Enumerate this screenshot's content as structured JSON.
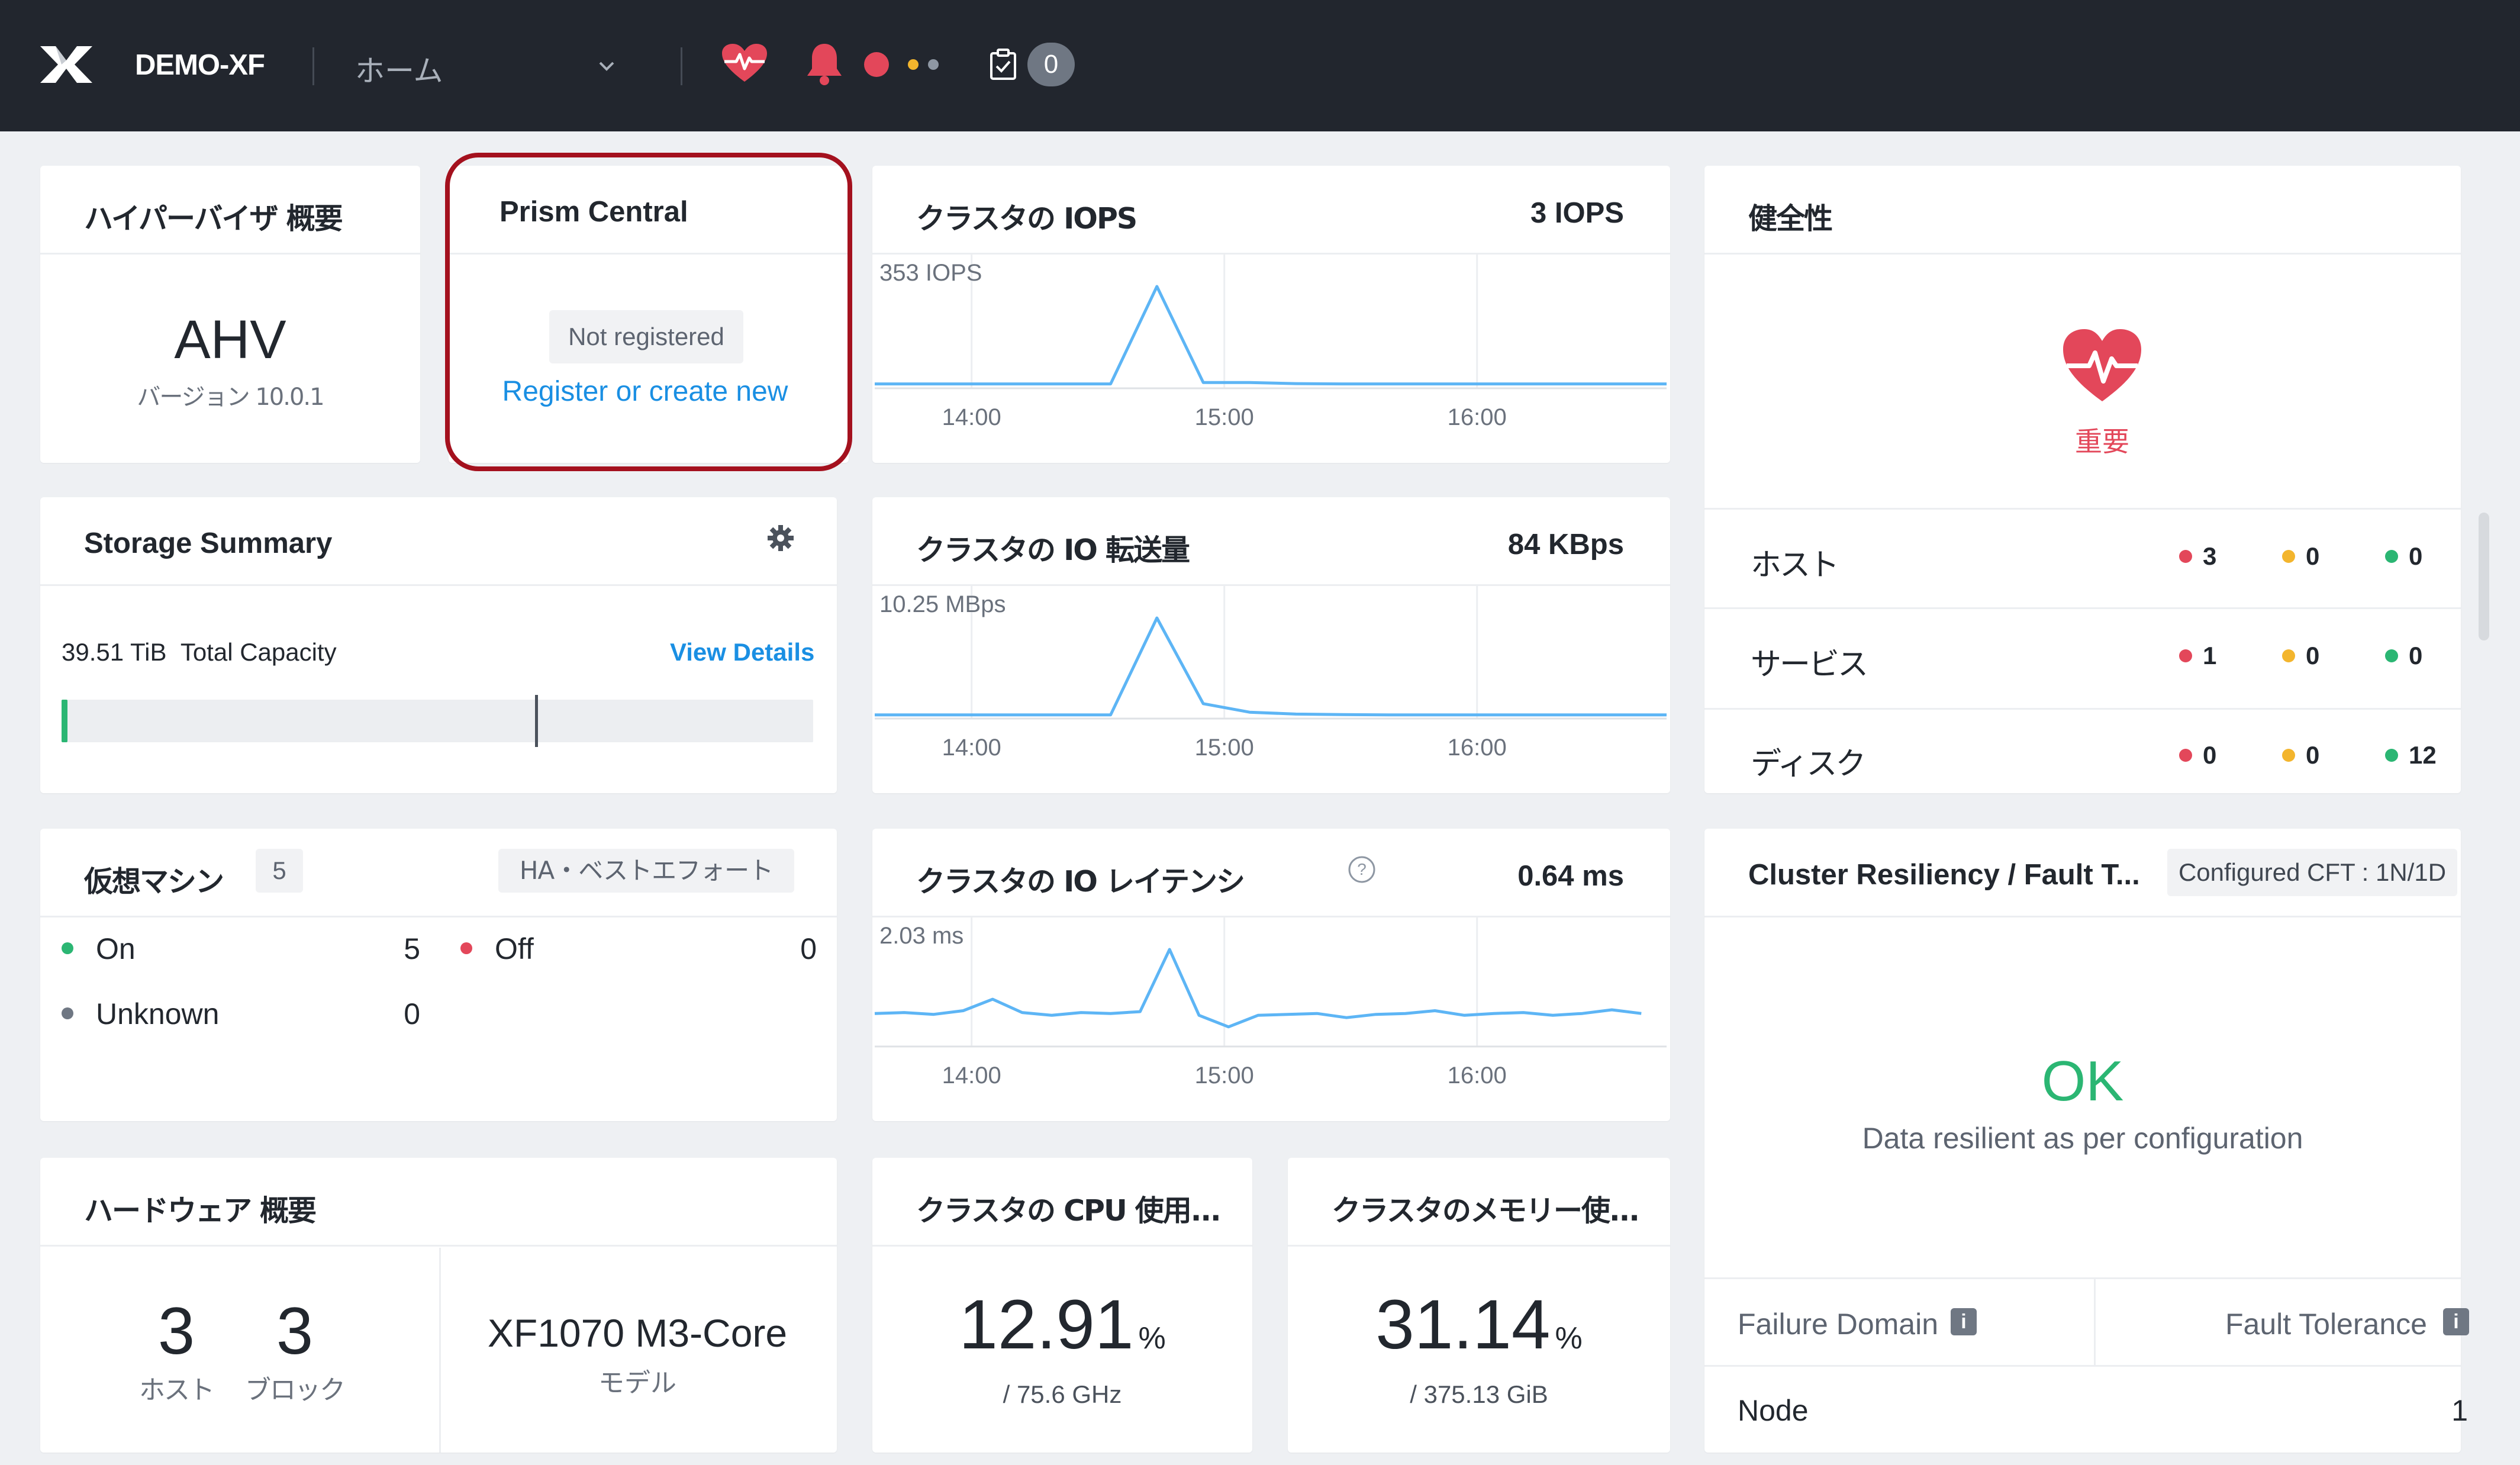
{
  "topbar": {
    "cluster_name": "DEMO-XF",
    "nav_label": "ホーム",
    "task_count": "0",
    "icons": [
      "x-logo-icon",
      "chevron-down-icon",
      "health-heart-icon",
      "bell-icon",
      "tasks-icon"
    ]
  },
  "hypervisor": {
    "title": "ハイパーバイザ 概要",
    "name": "AHV",
    "version": "バージョン 10.0.1"
  },
  "prism_central": {
    "title": "Prism Central",
    "status": "Not registered",
    "link": "Register or create new"
  },
  "iops": {
    "title": "クラスタの IOPS",
    "value": "3 IOPS",
    "peak_label": "353 IOPS"
  },
  "io_bw": {
    "title": "クラスタの IO 転送量",
    "value": "84 KBps",
    "peak_label": "10.25 MBps"
  },
  "latency": {
    "title": "クラスタの IO レイテンシ",
    "value": "0.64 ms",
    "peak_label": "2.03 ms"
  },
  "time_ticks": [
    "14:00",
    "15:00",
    "16:00"
  ],
  "storage": {
    "title": "Storage Summary",
    "capacity_value": "39.51 TiB",
    "capacity_label": "Total Capacity",
    "view_details": "View Details",
    "used_fraction": 0.005,
    "threshold_fraction": 0.63
  },
  "health": {
    "title": "健全性",
    "state": "重要",
    "rows": [
      {
        "label": "ホスト",
        "critical": "3",
        "warning": "0",
        "good": "0"
      },
      {
        "label": "サービス",
        "critical": "1",
        "warning": "0",
        "good": "0"
      },
      {
        "label": "ディスク",
        "critical": "0",
        "warning": "0",
        "good": "12"
      }
    ],
    "colors": {
      "critical": "#e3475a",
      "warning": "#f3b52d",
      "good": "#2bb673"
    }
  },
  "vms": {
    "title": "仮想マシン",
    "count": "5",
    "ha": "HA・ベストエフォート",
    "on_label": "On",
    "on_count": "5",
    "off_label": "Off",
    "off_count": "0",
    "unknown_label": "Unknown",
    "unknown_count": "0"
  },
  "resiliency": {
    "title": "Cluster Resiliency / Fault T...",
    "cft": "Configured CFT : 1N/1D",
    "status": "OK",
    "description": "Data resilient as per configuration",
    "col_failure_domain": "Failure Domain",
    "col_fault_tolerance": "Fault Tolerance",
    "row_domain": "Node",
    "row_tolerance": "1"
  },
  "hardware": {
    "title": "ハードウェア 概要",
    "hosts": "3",
    "hosts_label": "ホスト",
    "blocks": "3",
    "blocks_label": "ブロック",
    "model": "XF1070 M3-Core",
    "model_label": "モデル"
  },
  "cpu": {
    "title": "クラスタの CPU 使用...",
    "value": "12.91",
    "unit": "%",
    "total": "/ 75.6 GHz"
  },
  "memory": {
    "title": "クラスタのメモリー使...",
    "value": "31.14",
    "unit": "%",
    "total": "/ 375.13 GiB"
  },
  "chart_data": [
    {
      "type": "line",
      "title": "クラスタの IOPS",
      "x": [
        "13:37",
        "13:48",
        "14:00",
        "14:11",
        "14:22",
        "14:33",
        "14:44",
        "14:55",
        "15:06",
        "15:17",
        "15:28",
        "15:39",
        "15:50",
        "16:01",
        "16:12",
        "16:23",
        "16:34",
        "16:45"
      ],
      "series": [
        {
          "values": [
            3,
            3,
            3,
            3,
            3,
            3,
            353,
            8,
            8,
            4,
            3,
            3,
            3,
            3,
            3,
            3,
            3,
            3
          ]
        }
      ],
      "ylim": [
        0,
        353
      ]
    },
    {
      "type": "line",
      "title": "クラスタの IO 転送量",
      "x": [
        "13:37",
        "13:48",
        "14:00",
        "14:11",
        "14:22",
        "14:33",
        "14:44",
        "14:55",
        "15:06",
        "15:17",
        "15:28",
        "15:39",
        "15:50",
        "16:01",
        "16:12",
        "16:23",
        "16:34",
        "16:45"
      ],
      "series": [
        {
          "values": [
            0.02,
            0.02,
            0.02,
            0.02,
            0.02,
            0.02,
            10.25,
            1.2,
            0.3,
            0.1,
            0.05,
            0.02,
            0.02,
            0.02,
            0.02,
            0.02,
            0.02,
            0.02
          ]
        }
      ],
      "ylim": [
        0,
        10.25
      ]
    },
    {
      "type": "line",
      "title": "クラスタの IO レイテンシ",
      "x": [
        "13:37",
        "13:44",
        "13:51",
        "13:58",
        "14:05",
        "14:12",
        "14:19",
        "14:26",
        "14:33",
        "14:40",
        "14:47",
        "14:54",
        "15:01",
        "15:08",
        "15:15",
        "15:22",
        "15:29",
        "15:36",
        "15:43",
        "15:50",
        "15:57",
        "16:04",
        "16:11",
        "16:18",
        "16:25",
        "16:32",
        "16:39"
      ],
      "series": [
        {
          "values": [
            0.64,
            0.66,
            0.62,
            0.7,
            0.95,
            0.66,
            0.6,
            0.66,
            0.64,
            0.68,
            2.03,
            0.6,
            0.35,
            0.6,
            0.62,
            0.64,
            0.55,
            0.62,
            0.64,
            0.7,
            0.6,
            0.64,
            0.66,
            0.6,
            0.64,
            0.72,
            0.64
          ]
        }
      ],
      "ylim": [
        0,
        2.03
      ]
    }
  ]
}
